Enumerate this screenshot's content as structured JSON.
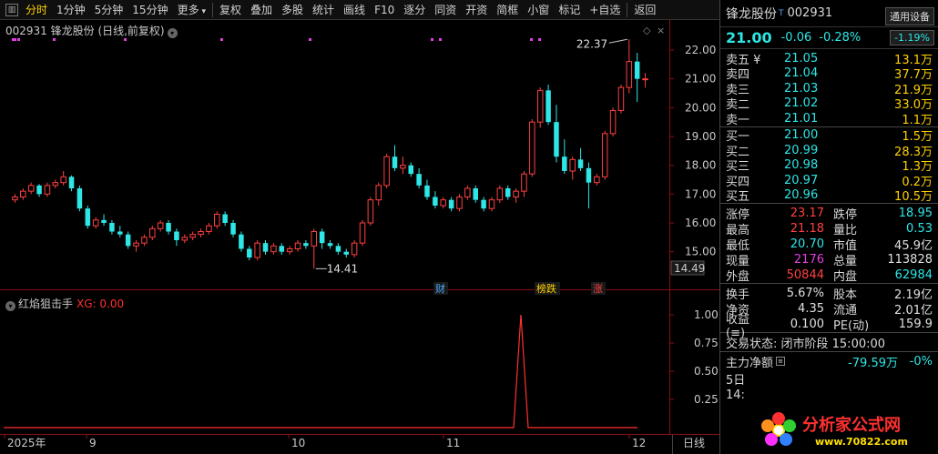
{
  "toolbar": {
    "items": [
      "分时",
      "1分钟",
      "5分钟",
      "15分钟",
      "更多",
      "复权",
      "叠加",
      "多股",
      "统计",
      "画线",
      "F10",
      "逐分",
      "同资",
      "开资",
      "简框",
      "小窗",
      "标记",
      "+自选",
      "返回"
    ]
  },
  "chart": {
    "title": "002931 锋龙股份 (日线,前复权)",
    "price_axis": [
      "22.00",
      "21.00",
      "20.00",
      "19.00",
      "18.00",
      "17.00",
      "16.00",
      "15.00"
    ],
    "current_price_tag": "14.49",
    "high_label": "22.37",
    "low_label": "14.41",
    "event_tags": [
      {
        "text": "财",
        "color": "#4aa8ff"
      },
      {
        "text": "榜跌",
        "color": "#ffd000"
      },
      {
        "text": "涨",
        "color": "#ff4040"
      }
    ],
    "x_axis": [
      "2025年",
      "9",
      "10",
      "11",
      "12"
    ],
    "x_axis_right": "日线",
    "up_color": "#ff4040",
    "down_color": "#2ee6e6"
  },
  "indicator": {
    "name": "红焰狙击手",
    "xg_label": "XG: 0.00",
    "axis": [
      "1.00",
      "0.75",
      "0.50",
      "0.25"
    ]
  },
  "chart_data": {
    "type": "candlestick",
    "candles": [
      [
        16.8,
        17.0,
        16.7,
        16.9
      ],
      [
        16.9,
        17.2,
        16.8,
        17.1
      ],
      [
        17.1,
        17.4,
        17.0,
        17.3
      ],
      [
        17.3,
        17.35,
        16.9,
        17.0
      ],
      [
        17.0,
        17.4,
        16.9,
        17.3
      ],
      [
        17.3,
        17.5,
        17.2,
        17.4
      ],
      [
        17.4,
        17.8,
        17.3,
        17.6
      ],
      [
        17.6,
        17.65,
        17.1,
        17.2
      ],
      [
        17.2,
        17.3,
        16.4,
        16.5
      ],
      [
        16.5,
        16.6,
        15.8,
        15.9
      ],
      [
        15.9,
        16.2,
        15.8,
        16.1
      ],
      [
        16.1,
        16.3,
        15.9,
        16.0
      ],
      [
        16.0,
        16.1,
        15.6,
        15.7
      ],
      [
        15.7,
        15.9,
        15.5,
        15.6
      ],
      [
        15.6,
        15.7,
        15.1,
        15.2
      ],
      [
        15.2,
        15.4,
        15.0,
        15.3
      ],
      [
        15.3,
        15.6,
        15.2,
        15.5
      ],
      [
        15.5,
        15.9,
        15.4,
        15.8
      ],
      [
        15.8,
        16.1,
        15.7,
        16.0
      ],
      [
        16.0,
        16.1,
        15.6,
        15.7
      ],
      [
        15.7,
        15.8,
        15.2,
        15.4
      ],
      [
        15.4,
        15.6,
        15.3,
        15.5
      ],
      [
        15.5,
        15.7,
        15.4,
        15.6
      ],
      [
        15.6,
        15.8,
        15.5,
        15.7
      ],
      [
        15.7,
        16.0,
        15.6,
        15.9
      ],
      [
        15.9,
        16.4,
        15.8,
        16.3
      ],
      [
        16.3,
        16.4,
        15.9,
        16.0
      ],
      [
        16.0,
        16.1,
        15.5,
        15.6
      ],
      [
        15.6,
        15.7,
        15.0,
        15.1
      ],
      [
        15.1,
        15.2,
        14.7,
        14.8
      ],
      [
        14.8,
        15.4,
        14.7,
        15.3
      ],
      [
        15.3,
        15.4,
        14.9,
        15.0
      ],
      [
        15.0,
        15.3,
        14.9,
        15.2
      ],
      [
        15.2,
        15.3,
        14.9,
        15.0
      ],
      [
        15.0,
        15.2,
        14.9,
        15.1
      ],
      [
        15.1,
        15.4,
        15.0,
        15.3
      ],
      [
        15.3,
        15.4,
        15.1,
        15.2
      ],
      [
        15.2,
        15.8,
        14.41,
        15.7
      ],
      [
        15.7,
        15.8,
        15.1,
        15.3
      ],
      [
        15.3,
        15.4,
        15.1,
        15.2
      ],
      [
        15.2,
        15.3,
        14.9,
        15.0
      ],
      [
        15.0,
        15.1,
        14.8,
        14.9
      ],
      [
        14.9,
        15.4,
        14.8,
        15.3
      ],
      [
        15.3,
        16.1,
        15.2,
        16.0
      ],
      [
        16.0,
        16.9,
        15.9,
        16.8
      ],
      [
        16.8,
        17.4,
        16.6,
        17.3
      ],
      [
        17.3,
        18.4,
        17.2,
        18.3
      ],
      [
        18.3,
        18.7,
        17.8,
        17.9
      ],
      [
        17.9,
        18.3,
        17.7,
        18.0
      ],
      [
        18.0,
        18.1,
        17.6,
        17.7
      ],
      [
        17.7,
        17.9,
        17.2,
        17.3
      ],
      [
        17.3,
        17.5,
        16.8,
        16.9
      ],
      [
        16.9,
        17.1,
        16.5,
        16.6
      ],
      [
        16.6,
        16.9,
        16.5,
        16.8
      ],
      [
        16.8,
        16.9,
        16.4,
        16.5
      ],
      [
        16.5,
        17.0,
        16.4,
        16.9
      ],
      [
        16.9,
        17.3,
        16.8,
        17.2
      ],
      [
        17.2,
        17.3,
        16.7,
        16.8
      ],
      [
        16.8,
        16.9,
        16.4,
        16.5
      ],
      [
        16.5,
        16.9,
        16.4,
        16.8
      ],
      [
        16.8,
        17.3,
        16.7,
        17.2
      ],
      [
        17.2,
        17.3,
        16.8,
        16.9
      ],
      [
        16.9,
        17.2,
        16.7,
        17.1
      ],
      [
        17.1,
        17.8,
        16.9,
        17.7
      ],
      [
        17.7,
        19.6,
        17.6,
        19.5
      ],
      [
        19.5,
        20.7,
        19.3,
        20.6
      ],
      [
        20.6,
        20.8,
        19.4,
        19.5
      ],
      [
        19.5,
        20.1,
        18.1,
        18.3
      ],
      [
        18.3,
        18.9,
        17.7,
        17.8
      ],
      [
        17.8,
        18.3,
        17.5,
        18.2
      ],
      [
        18.2,
        18.6,
        17.8,
        17.9
      ],
      [
        17.9,
        18.1,
        16.5,
        17.4
      ],
      [
        17.4,
        17.7,
        17.3,
        17.6
      ],
      [
        17.6,
        19.2,
        17.5,
        19.1
      ],
      [
        19.1,
        20.0,
        19.0,
        19.9
      ],
      [
        19.9,
        20.8,
        19.8,
        20.7
      ],
      [
        20.7,
        22.37,
        20.5,
        21.6
      ],
      [
        21.6,
        21.9,
        20.2,
        21.0
      ],
      [
        21.0,
        21.2,
        20.7,
        21.0
      ]
    ],
    "indicator_xg": "spike to 1.00 near late November, 0 elsewhere",
    "ylim": [
      14.2,
      22.6
    ]
  },
  "quote": {
    "name": "锋龙股份",
    "code": "002931",
    "tag": "通用设备",
    "price": "21.00",
    "change": "-0.06",
    "pct": "-0.28%",
    "pct2": "-1.19%",
    "asks": [
      {
        "label": "卖五 ¥",
        "price": "21.05",
        "vol": "13.1万"
      },
      {
        "label": "卖四",
        "price": "21.04",
        "vol": "37.7万"
      },
      {
        "label": "卖三",
        "price": "21.03",
        "vol": "21.9万"
      },
      {
        "label": "卖二",
        "price": "21.02",
        "vol": "33.0万"
      },
      {
        "label": "卖一",
        "price": "21.01",
        "vol": "1.1万"
      }
    ],
    "bids": [
      {
        "label": "买一",
        "price": "21.00",
        "vol": "1.5万"
      },
      {
        "label": "买二",
        "price": "20.99",
        "vol": "28.3万"
      },
      {
        "label": "买三",
        "price": "20.98",
        "vol": "1.3万"
      },
      {
        "label": "买四",
        "price": "20.97",
        "vol": "0.2万"
      },
      {
        "label": "买五",
        "price": "20.96",
        "vol": "10.5万"
      }
    ],
    "stats1": [
      {
        "l1": "涨停",
        "v1": "23.17",
        "c1": "red",
        "l2": "跌停",
        "v2": "18.95",
        "c2": "cyan"
      },
      {
        "l1": "最高",
        "v1": "21.18",
        "c1": "red",
        "l2": "量比",
        "v2": "0.53",
        "c2": "cyan"
      },
      {
        "l1": "最低",
        "v1": "20.70",
        "c1": "cyan",
        "l2": "市值",
        "v2": "45.9亿",
        "c2": "white"
      },
      {
        "l1": "现量",
        "v1": "2176",
        "c1": "mag",
        "l2": "总量",
        "v2": "113828",
        "c2": "white"
      },
      {
        "l1": "外盘",
        "v1": "50844",
        "c1": "red",
        "l2": "内盘",
        "v2": "62984",
        "c2": "cyan"
      }
    ],
    "stats2": [
      {
        "l1": "换手",
        "v1": "5.67%",
        "c1": "white",
        "l2": "股本",
        "v2": "2.19亿",
        "c2": "white"
      },
      {
        "l1": "净资",
        "v1": "4.35",
        "c1": "white",
        "l2": "流通",
        "v2": "2.01亿",
        "c2": "white"
      },
      {
        "l1": "收益(≡)",
        "v1": "0.100",
        "c1": "white",
        "l2": "PE(动)",
        "v2": "159.9",
        "c2": "white"
      }
    ],
    "state": "交易状态: 闭市阶段 15:00:00",
    "flow_label": "主力净额",
    "flow_value": "-79.59万",
    "flow_pct": "-0%",
    "bottom1": "5日",
    "bottom2": "14:",
    "logo_text": "分析家公式网",
    "logo_url": "www.70822.com"
  }
}
